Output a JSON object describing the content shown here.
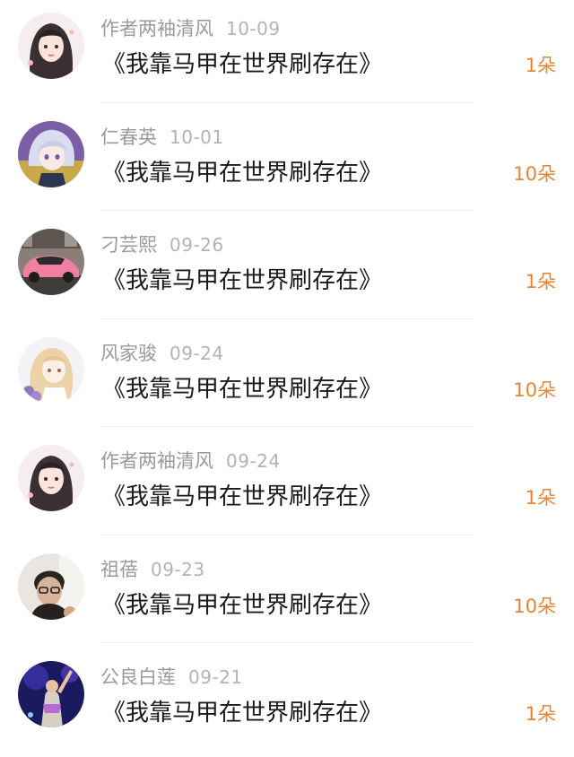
{
  "items": [
    {
      "name": "作者两袖清风",
      "date": "10-09",
      "book": "《我靠马甲在世界刷存在》",
      "amount": "1朵",
      "avatar": "anime-girl-dark-hair-icon"
    },
    {
      "name": "仁春英",
      "date": "10-01",
      "book": "《我靠马甲在世界刷存在》",
      "amount": "10朵",
      "avatar": "anime-boy-silver-hair-icon"
    },
    {
      "name": "刁芸熙",
      "date": "09-26",
      "book": "《我靠马甲在世界刷存在》",
      "amount": "1朵",
      "avatar": "pink-car-icon"
    },
    {
      "name": "风家骏",
      "date": "09-24",
      "book": "《我靠马甲在世界刷存在》",
      "amount": "10朵",
      "avatar": "anime-girl-blonde-flowers-icon"
    },
    {
      "name": "作者两袖清风",
      "date": "09-24",
      "book": "《我靠马甲在世界刷存在》",
      "amount": "1朵",
      "avatar": "anime-girl-dark-hair-icon"
    },
    {
      "name": "祖蓓",
      "date": "09-23",
      "book": "《我靠马甲在世界刷存在》",
      "amount": "10朵",
      "avatar": "man-glasses-photo-icon"
    },
    {
      "name": "公良白莲",
      "date": "09-21",
      "book": "《我靠马甲在世界刷存在》",
      "amount": "1朵",
      "avatar": "concert-performer-icon"
    }
  ],
  "colors": {
    "name": "#9a9a9a",
    "date": "#b3b3b3",
    "book": "#1a1a1a",
    "amount": "#e98431"
  }
}
